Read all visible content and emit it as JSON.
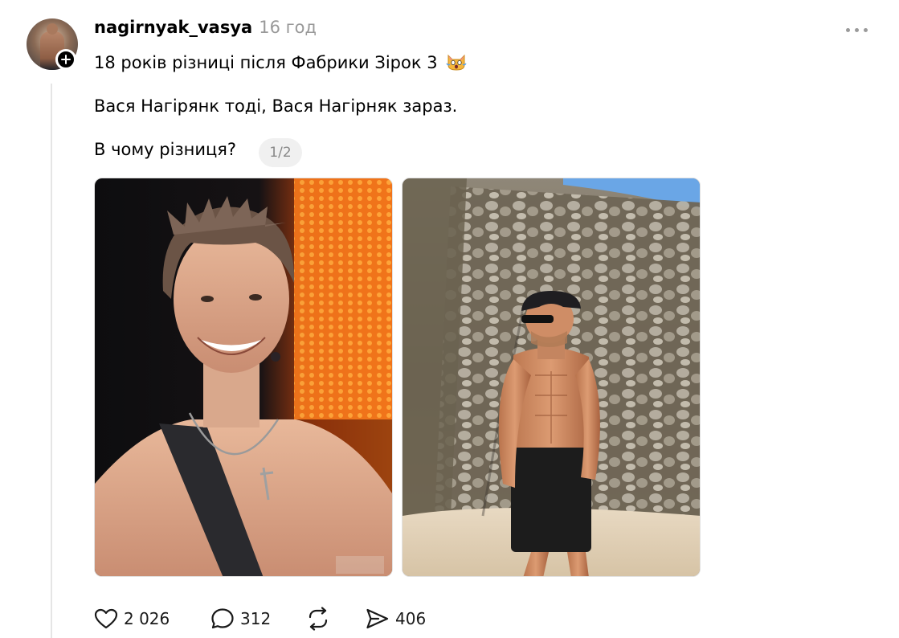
{
  "post": {
    "username": "nagirnyak_vasya",
    "timestamp": "16 год",
    "line1": "18 років різниці після Фабрики Зірок 3",
    "line2": "Вася Нагірянк тоді, Вася Нагірняк зараз.",
    "line3": "В чому різниця?",
    "page_indicator": "1/2",
    "images": [
      {
        "icon": "photo-then"
      },
      {
        "icon": "photo-now"
      }
    ],
    "emoji": "scream-cat-emoji"
  },
  "actions": {
    "likes": "2 026",
    "comments": "312",
    "shares": "406"
  },
  "colors": {
    "text": "#000000",
    "muted": "#999999",
    "thread_line": "#e5e5e5",
    "pill_bg": "#f0f0f0"
  }
}
